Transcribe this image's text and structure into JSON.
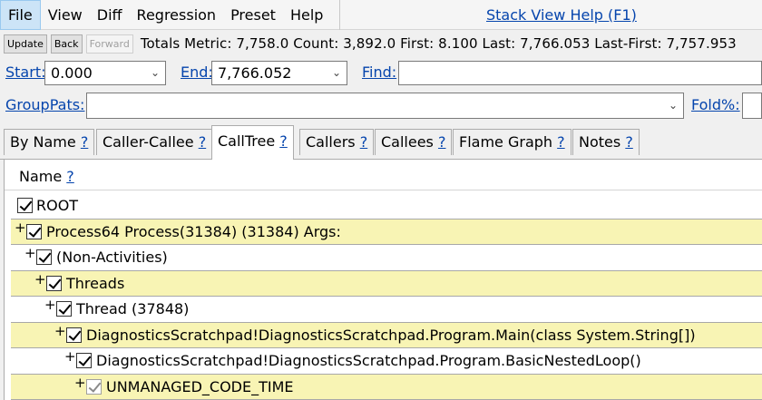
{
  "menu": {
    "items": [
      "File",
      "View",
      "Diff",
      "Regression",
      "Preset",
      "Help"
    ],
    "help_link": "Stack View Help (F1)"
  },
  "toolbar": {
    "update": "Update",
    "back": "Back",
    "forward": "Forward",
    "totals": "Totals Metric: 7,758.0  Count: 3,892.0  First: 8.100 Last: 7,766.053  Last-First: 7,757.953"
  },
  "range": {
    "start_label": "Start:",
    "start_value": "0.000",
    "end_label": "End:",
    "end_value": "7,766.052",
    "find_label": "Find:",
    "find_value": ""
  },
  "group": {
    "grouppats_label": "GroupPats:",
    "grouppats_value": "",
    "fold_label": "Fold%:",
    "fold_value": ""
  },
  "tabs": [
    {
      "label": "By Name",
      "q": "?"
    },
    {
      "label": "Caller-Callee",
      "q": "?"
    },
    {
      "label": "CallTree",
      "q": "?"
    },
    {
      "label": "Callers",
      "q": "?"
    },
    {
      "label": "Callees",
      "q": "?"
    },
    {
      "label": "Flame Graph",
      "q": "?"
    },
    {
      "label": "Notes",
      "q": "?"
    }
  ],
  "selected_tab": "CallTree",
  "grid": {
    "header_name": "Name",
    "header_q": "?",
    "rows": [
      {
        "expander": "",
        "text": "ROOT"
      },
      {
        "expander": "+",
        "text": "Process64 Process(31384) (31384) Args: "
      },
      {
        "expander": "+",
        "text": "(Non-Activities)"
      },
      {
        "expander": "+",
        "text": "Threads"
      },
      {
        "expander": "+",
        "text": "Thread (37848)"
      },
      {
        "expander": "+",
        "text": "DiagnosticsScratchpad!DiagnosticsScratchpad.Program.Main(class System.String[])"
      },
      {
        "expander": "+",
        "text": "DiagnosticsScratchpad!DiagnosticsScratchpad.Program.BasicNestedLoop()"
      },
      {
        "expander": "+",
        "text": "UNMANAGED_CODE_TIME"
      }
    ]
  },
  "colors": {
    "highlight_row": "#f8f4b4",
    "link": "#0645ad",
    "menu_active": "#cce4f7"
  },
  "icons": {
    "dropdown": "chevron-down-icon",
    "checkbox": "checkbox-checked-icon"
  }
}
